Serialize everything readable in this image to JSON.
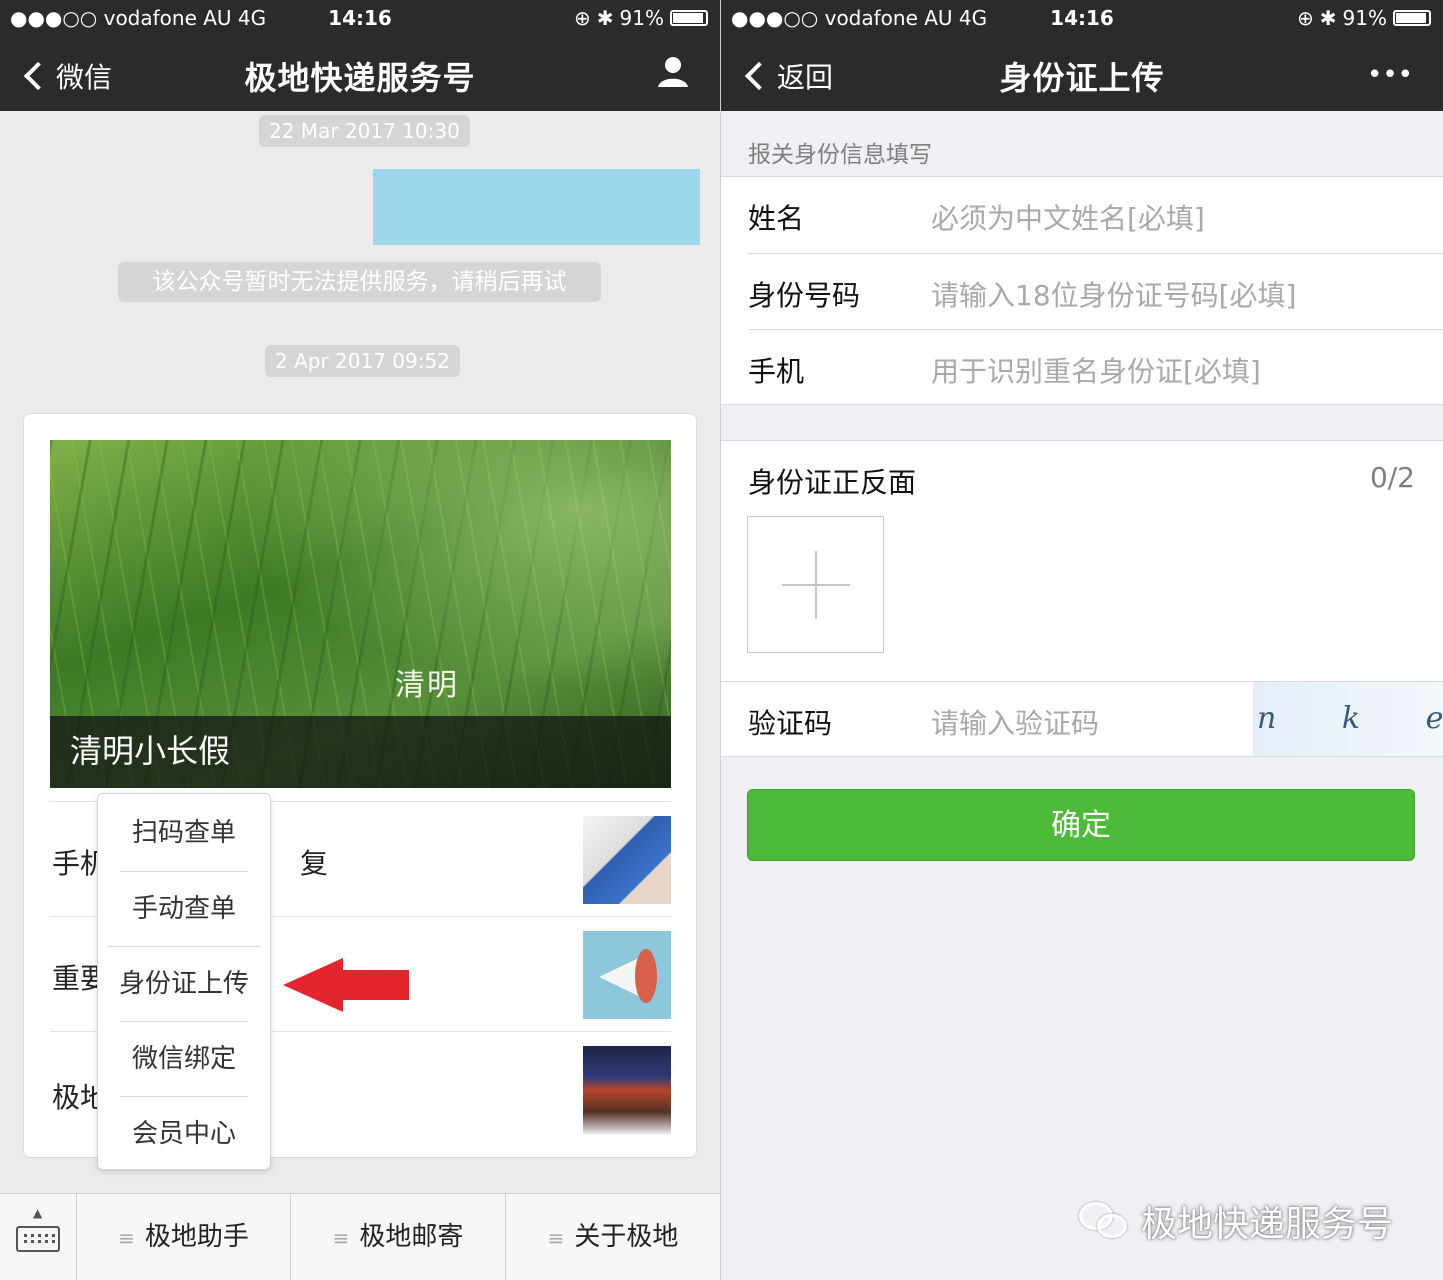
{
  "left": {
    "status": {
      "carrier": "●●●○○ vodafone AU   4G",
      "time": "14:16",
      "battery": "91%"
    },
    "nav": {
      "back_label": "微信",
      "title": "极地快递服务号"
    },
    "timestamps": [
      "22 Mar 2017 10:30",
      "2 Apr 2017 09:52"
    ],
    "system_message": "该公众号暂时无法提供服务，请稍后再试",
    "article": {
      "hero_caption": "清明小长假",
      "hero_seal": "清明",
      "rows": [
        {
          "left_text": "手机",
          "right_text": "复"
        },
        {
          "left_text": "重要",
          "right_text": ""
        },
        {
          "left_text": "极地",
          "right_text": ""
        }
      ]
    },
    "popup_menu": [
      "扫码查单",
      "手动查单",
      "身份证上传",
      "微信绑定",
      "会员中心"
    ],
    "tabbar": [
      "极地助手",
      "极地邮寄",
      "关于极地"
    ],
    "arrow_color": "#e3262d"
  },
  "right": {
    "status": {
      "carrier": "●●●○○ vodafone AU   4G",
      "time": "14:16",
      "battery": "91%"
    },
    "nav": {
      "back_label": "返回",
      "title": "身份证上传",
      "more": "•••"
    },
    "section_header": "报关身份信息填写",
    "fields": [
      {
        "label": "姓名",
        "placeholder": "必须为中文姓名[必填]"
      },
      {
        "label": "身份号码",
        "placeholder": "请输入18位身份证号码[必填]"
      },
      {
        "label": "手机",
        "placeholder": "用于识别重名身份证[必填]"
      }
    ],
    "upload": {
      "title": "身份证正反面",
      "count": "0/2"
    },
    "captcha": {
      "label": "验证码",
      "placeholder": "请输入验证码",
      "image_text": "n k e w"
    },
    "confirm_label": "确定",
    "confirm_color": "#4eba3a",
    "watermark": "极地快递服务号"
  }
}
